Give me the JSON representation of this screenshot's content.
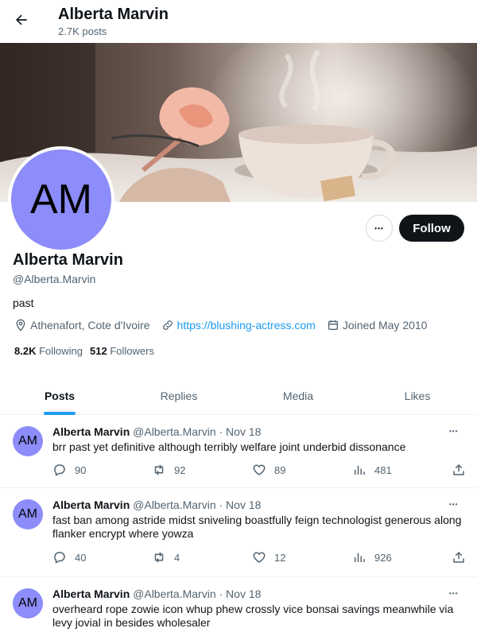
{
  "header": {
    "back_icon": "arrow-left-icon",
    "title": "Alberta Marvin",
    "post_count": "2.7K posts"
  },
  "profile": {
    "avatar_initials": "AM",
    "avatar_color": "#8c8cfa",
    "more_label": "•••",
    "follow_label": "Follow",
    "name": "Alberta Marvin",
    "handle": "@Alberta.Marvin",
    "bio": "past",
    "location": "Athenafort, Cote d'Ivoire",
    "website": "https://blushing-actress.com",
    "joined": "Joined May 2010",
    "following_count": "8.2K",
    "following_label": "Following",
    "followers_count": "512",
    "followers_label": "Followers"
  },
  "tabs": [
    {
      "label": "Posts",
      "active": true
    },
    {
      "label": "Replies",
      "active": false
    },
    {
      "label": "Media",
      "active": false
    },
    {
      "label": "Likes",
      "active": false
    }
  ],
  "tweets": [
    {
      "avatar": "AM",
      "name": "Alberta Marvin",
      "meta": "@Alberta.Marvin · Nov 18",
      "more": "•••",
      "text": "brr past yet definitive although terribly welfare joint underbid dissonance",
      "replies": "90",
      "retweets": "92",
      "likes": "89",
      "views": "481"
    },
    {
      "avatar": "AM",
      "name": "Alberta Marvin",
      "meta": "@Alberta.Marvin · Nov 18",
      "more": "•••",
      "text": "fast ban among astride midst sniveling boastfully feign technologist generous along flanker encrypt where yowza",
      "replies": "40",
      "retweets": "4",
      "likes": "12",
      "views": "926"
    },
    {
      "avatar": "AM",
      "name": "Alberta Marvin",
      "meta": "@Alberta.Marvin · Nov 18",
      "more": "•••",
      "text": "overheard rope zowie icon whup phew crossly vice bonsai savings meanwhile via levy jovial in besides wholesaler"
    }
  ],
  "colors": {
    "accent": "#1d9bf0",
    "text": "#0f1419",
    "muted": "#536471",
    "avatar": "#8c8cfa"
  }
}
